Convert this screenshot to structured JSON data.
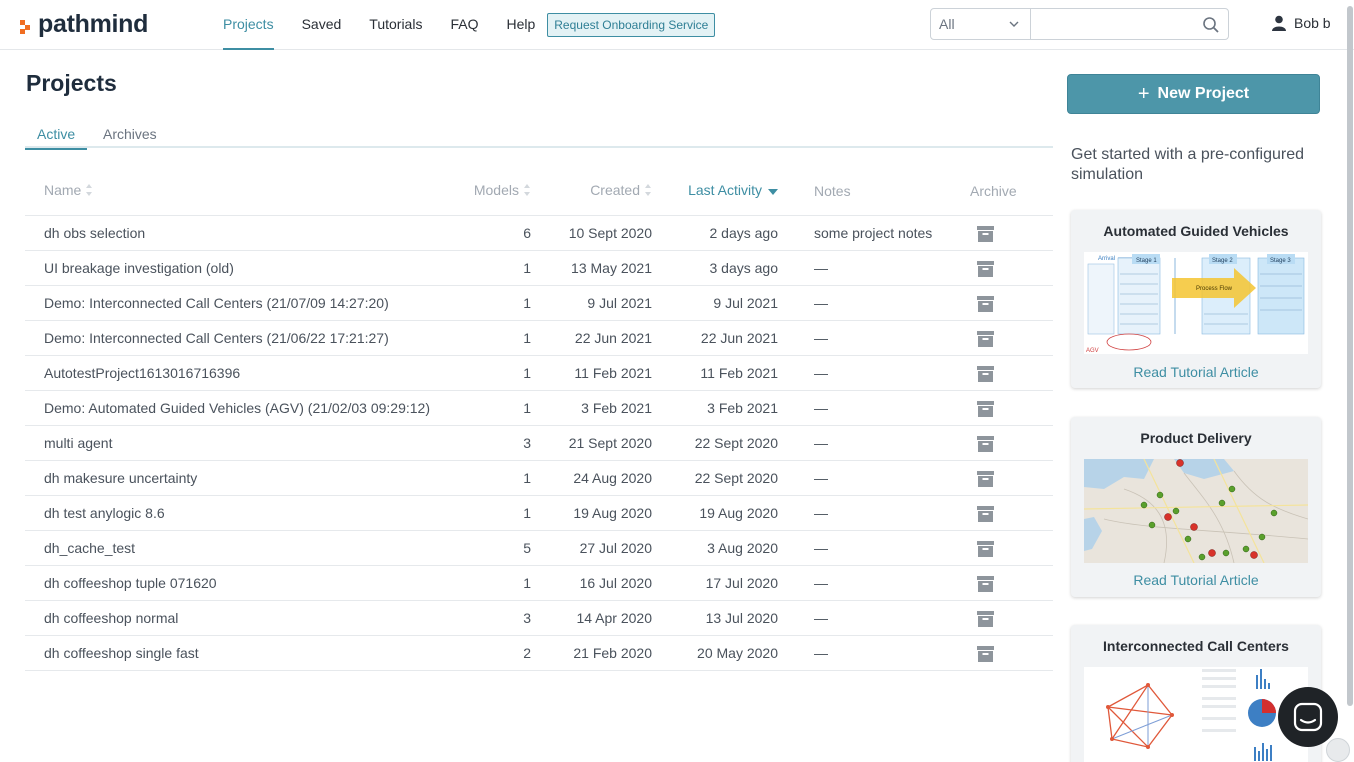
{
  "brand": {
    "name": "pathmind"
  },
  "nav": {
    "items": [
      {
        "label": "Projects",
        "active": true
      },
      {
        "label": "Saved"
      },
      {
        "label": "Tutorials"
      },
      {
        "label": "FAQ"
      },
      {
        "label": "Help"
      }
    ],
    "onboarding_button": "Request Onboarding Service"
  },
  "search": {
    "scope_selected": "All",
    "value": ""
  },
  "user": {
    "name": "Bob b"
  },
  "page": {
    "title": "Projects"
  },
  "tabs": [
    {
      "label": "Active",
      "active": true
    },
    {
      "label": "Archives"
    }
  ],
  "table": {
    "columns": {
      "name": "Name",
      "models": "Models",
      "created": "Created",
      "last_activity": "Last Activity",
      "notes": "Notes",
      "archive": "Archive"
    },
    "rows": [
      {
        "name": "dh obs selection",
        "models": "6",
        "created": "10 Sept 2020",
        "last_activity": "2 days ago",
        "notes": "some project notes"
      },
      {
        "name": "UI breakage investigation (old)",
        "models": "1",
        "created": "13 May 2021",
        "last_activity": "3 days ago",
        "notes": "—"
      },
      {
        "name": "Demo: Interconnected Call Centers (21/07/09 14:27:20)",
        "models": "1",
        "created": "9 Jul 2021",
        "last_activity": "9 Jul 2021",
        "notes": "—"
      },
      {
        "name": "Demo: Interconnected Call Centers (21/06/22 17:21:27)",
        "models": "1",
        "created": "22 Jun 2021",
        "last_activity": "22 Jun 2021",
        "notes": "—"
      },
      {
        "name": "AutotestProject1613016716396",
        "models": "1",
        "created": "11 Feb 2021",
        "last_activity": "11 Feb 2021",
        "notes": "—"
      },
      {
        "name": "Demo: Automated Guided Vehicles (AGV) (21/02/03 09:29:12)",
        "models": "1",
        "created": "3 Feb 2021",
        "last_activity": "3 Feb 2021",
        "notes": "—"
      },
      {
        "name": "multi agent",
        "models": "3",
        "created": "21 Sept 2020",
        "last_activity": "22 Sept 2020",
        "notes": "—"
      },
      {
        "name": "dh makesure uncertainty",
        "models": "1",
        "created": "24 Aug 2020",
        "last_activity": "22 Sept 2020",
        "notes": "—"
      },
      {
        "name": "dh test anylogic 8.6",
        "models": "1",
        "created": "19 Aug 2020",
        "last_activity": "19 Aug 2020",
        "notes": "—"
      },
      {
        "name": "dh_cache_test",
        "models": "5",
        "created": "27 Jul 2020",
        "last_activity": "3 Aug 2020",
        "notes": "—"
      },
      {
        "name": "dh coffeeshop tuple 071620",
        "models": "1",
        "created": "16 Jul 2020",
        "last_activity": "17 Jul 2020",
        "notes": "—"
      },
      {
        "name": "dh coffeeshop normal",
        "models": "3",
        "created": "14 Apr 2020",
        "last_activity": "13 Jul 2020",
        "notes": "—"
      },
      {
        "name": "dh coffeeshop single fast",
        "models": "2",
        "created": "21 Feb 2020",
        "last_activity": "20 May 2020",
        "notes": "—"
      }
    ]
  },
  "sidebar": {
    "new_project_label": "New Project",
    "intro": "Get started with a pre-configured simulation",
    "cards": [
      {
        "title": "Automated Guided Vehicles",
        "link": "Read Tutorial Article"
      },
      {
        "title": "Product Delivery",
        "link": "Read Tutorial Article"
      },
      {
        "title": "Interconnected Call Centers"
      }
    ],
    "agv_diagram": {
      "stages": [
        "Stage 1",
        "Stage 2",
        "Stage 3"
      ],
      "arrow_label": "Process Flow",
      "tag": "AGV",
      "arrival": "Arrival"
    }
  },
  "colors": {
    "accent": "#3e8ea3",
    "logo": "#f06d22",
    "primary_button": "#4d96a9"
  }
}
